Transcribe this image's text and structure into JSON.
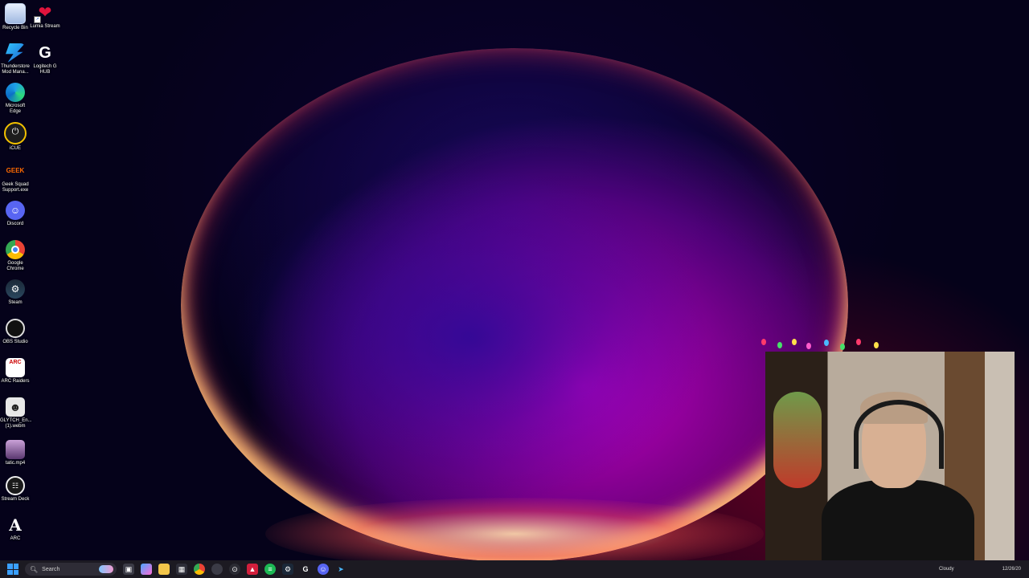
{
  "desktop": {
    "icons": [
      {
        "label": "Recycle Bin",
        "icon": "recycle-bin-icon"
      },
      {
        "label": "Lumia Stream",
        "icon": "lumia-stream-icon"
      },
      {
        "label": "Thunderstore Mod Mana...",
        "icon": "thunderstore-icon"
      },
      {
        "label": "Logitech G HUB",
        "icon": "logitech-ghub-icon"
      },
      {
        "label": "Microsoft Edge",
        "icon": "edge-icon"
      },
      {
        "label": "iCUE",
        "icon": "icue-icon"
      },
      {
        "label": "Geek Squad Support.exe",
        "icon": "geek-squad-icon"
      },
      {
        "label": "Discord",
        "icon": "discord-icon"
      },
      {
        "label": "Google Chrome",
        "icon": "chrome-icon"
      },
      {
        "label": "Steam",
        "icon": "steam-icon"
      },
      {
        "label": "OBS Studio",
        "icon": "obs-icon"
      },
      {
        "label": "ARC Raiders",
        "icon": "arc-raiders-icon"
      },
      {
        "label": "GLYTCH_En... (1).webm",
        "icon": "video-file-icon"
      },
      {
        "label": "tatic.mp4",
        "icon": "video-file-icon"
      },
      {
        "label": "Stream Deck",
        "icon": "stream-deck-icon"
      },
      {
        "label": "ARC",
        "icon": "arc-icon"
      }
    ]
  },
  "taskbar": {
    "search_placeholder": "Search",
    "apps": [
      "task-view-icon",
      "copilot-icon",
      "file-explorer-icon",
      "store-icon",
      "chrome-icon",
      "app-icon",
      "app-icon",
      "app-icon",
      "spotify-icon",
      "steam-icon",
      "logitech-icon",
      "discord-icon",
      "arrow-icon"
    ],
    "weather": "Cloudy",
    "date": "12/26/20"
  },
  "colors": {
    "taskbar_bg": "#1c1a22",
    "accent": "#3aa0ff"
  }
}
